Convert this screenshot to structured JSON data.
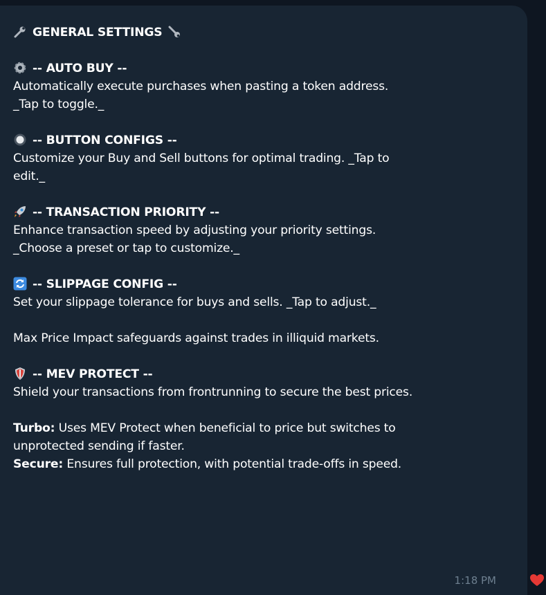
{
  "message": {
    "title": "GENERAL SETTINGS",
    "sections": [
      {
        "icon": "gear-icon",
        "heading": "-- AUTO BUY --",
        "lines": [
          "Automatically execute purchases when pasting a token address.",
          "_Tap to toggle._"
        ]
      },
      {
        "icon": "radio-button-icon",
        "heading": "-- BUTTON CONFIGS --",
        "lines": [
          "Customize your Buy and Sell buttons for optimal trading. _Tap to",
          "edit._"
        ]
      },
      {
        "icon": "rocket-icon",
        "heading": "-- TRANSACTION PRIORITY --",
        "lines": [
          "Enhance transaction speed by adjusting your priority settings.",
          "_Choose a preset or tap to customize._"
        ]
      },
      {
        "icon": "refresh-arrows-icon",
        "heading": "-- SLIPPAGE CONFIG --",
        "lines": [
          "Set your slippage tolerance for buys and sells. _Tap to adjust._"
        ],
        "extra": "Max Price Impact safeguards against trades in illiquid markets."
      },
      {
        "icon": "shield-icon",
        "heading": "-- MEV PROTECT --",
        "lines": [
          "Shield your transactions from frontrunning to secure the best prices."
        ]
      }
    ],
    "turbo": {
      "label": "Turbo:",
      "text_1": " Uses MEV Protect when beneficial to price but switches to",
      "text_2": "unprotected sending if faster."
    },
    "secure": {
      "label": "Secure:",
      "text": " Ensures full protection, with potential trade-offs in speed."
    },
    "time": "1:18 PM",
    "reaction": "heart-icon"
  },
  "colors": {
    "background": "#0e1621",
    "bubble": "#182533",
    "text": "#ffffff",
    "time": "#6d7f8f",
    "heart": "#e53935"
  }
}
